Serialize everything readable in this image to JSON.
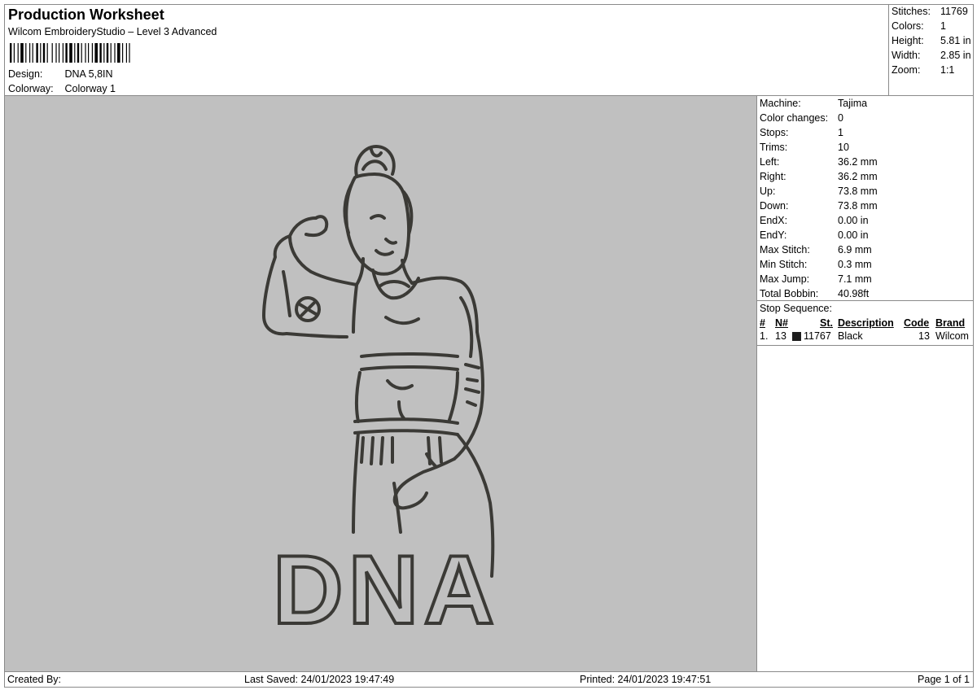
{
  "header": {
    "title": "Production Worksheet",
    "subtitle": "Wilcom EmbroideryStudio – Level 3 Advanced",
    "design_label": "Design:",
    "design_value": "DNA 5,8IN",
    "colorway_label": "Colorway:",
    "colorway_value": "Colorway 1"
  },
  "summary": [
    {
      "label": "Stitches:",
      "value": "11769"
    },
    {
      "label": "Colors:",
      "value": "1"
    },
    {
      "label": "Height:",
      "value": "5.81 in"
    },
    {
      "label": "Width:",
      "value": "2.85 in"
    },
    {
      "label": "Zoom:",
      "value": "1:1"
    }
  ],
  "details": [
    {
      "label": "Machine:",
      "value": "Tajima"
    },
    {
      "label": "Color changes:",
      "value": "0"
    },
    {
      "label": "Stops:",
      "value": "1"
    },
    {
      "label": "Trims:",
      "value": "10"
    },
    {
      "label": "Left:",
      "value": "36.2 mm"
    },
    {
      "label": "Right:",
      "value": "36.2 mm"
    },
    {
      "label": "Up:",
      "value": "73.8 mm"
    },
    {
      "label": "Down:",
      "value": "73.8 mm"
    },
    {
      "label": "EndX:",
      "value": "0.00 in"
    },
    {
      "label": "EndY:",
      "value": "0.00 in"
    },
    {
      "label": "Max Stitch:",
      "value": "6.9 mm"
    },
    {
      "label": "Min Stitch:",
      "value": "0.3 mm"
    },
    {
      "label": "Max Jump:",
      "value": "7.1 mm"
    },
    {
      "label": "Total Bobbin:",
      "value": "40.98ft"
    }
  ],
  "stop_sequence": {
    "title": "Stop Sequence:",
    "columns": [
      "#",
      "N#",
      "St.",
      "Description",
      "Code",
      "Brand"
    ],
    "rows": [
      {
        "num": "1.",
        "needle": "13",
        "color": "#1e1e1e",
        "stitches": "11767",
        "description": "Black",
        "code": "13",
        "brand": "Wilcom"
      }
    ]
  },
  "design_text": "DNA",
  "thread_color": "#3b3a36",
  "footer": {
    "created_by": "Created By:",
    "last_saved": "Last Saved: 24/01/2023 19:47:49",
    "printed": "Printed: 24/01/2023 19:47:51",
    "page": "Page 1 of 1"
  }
}
